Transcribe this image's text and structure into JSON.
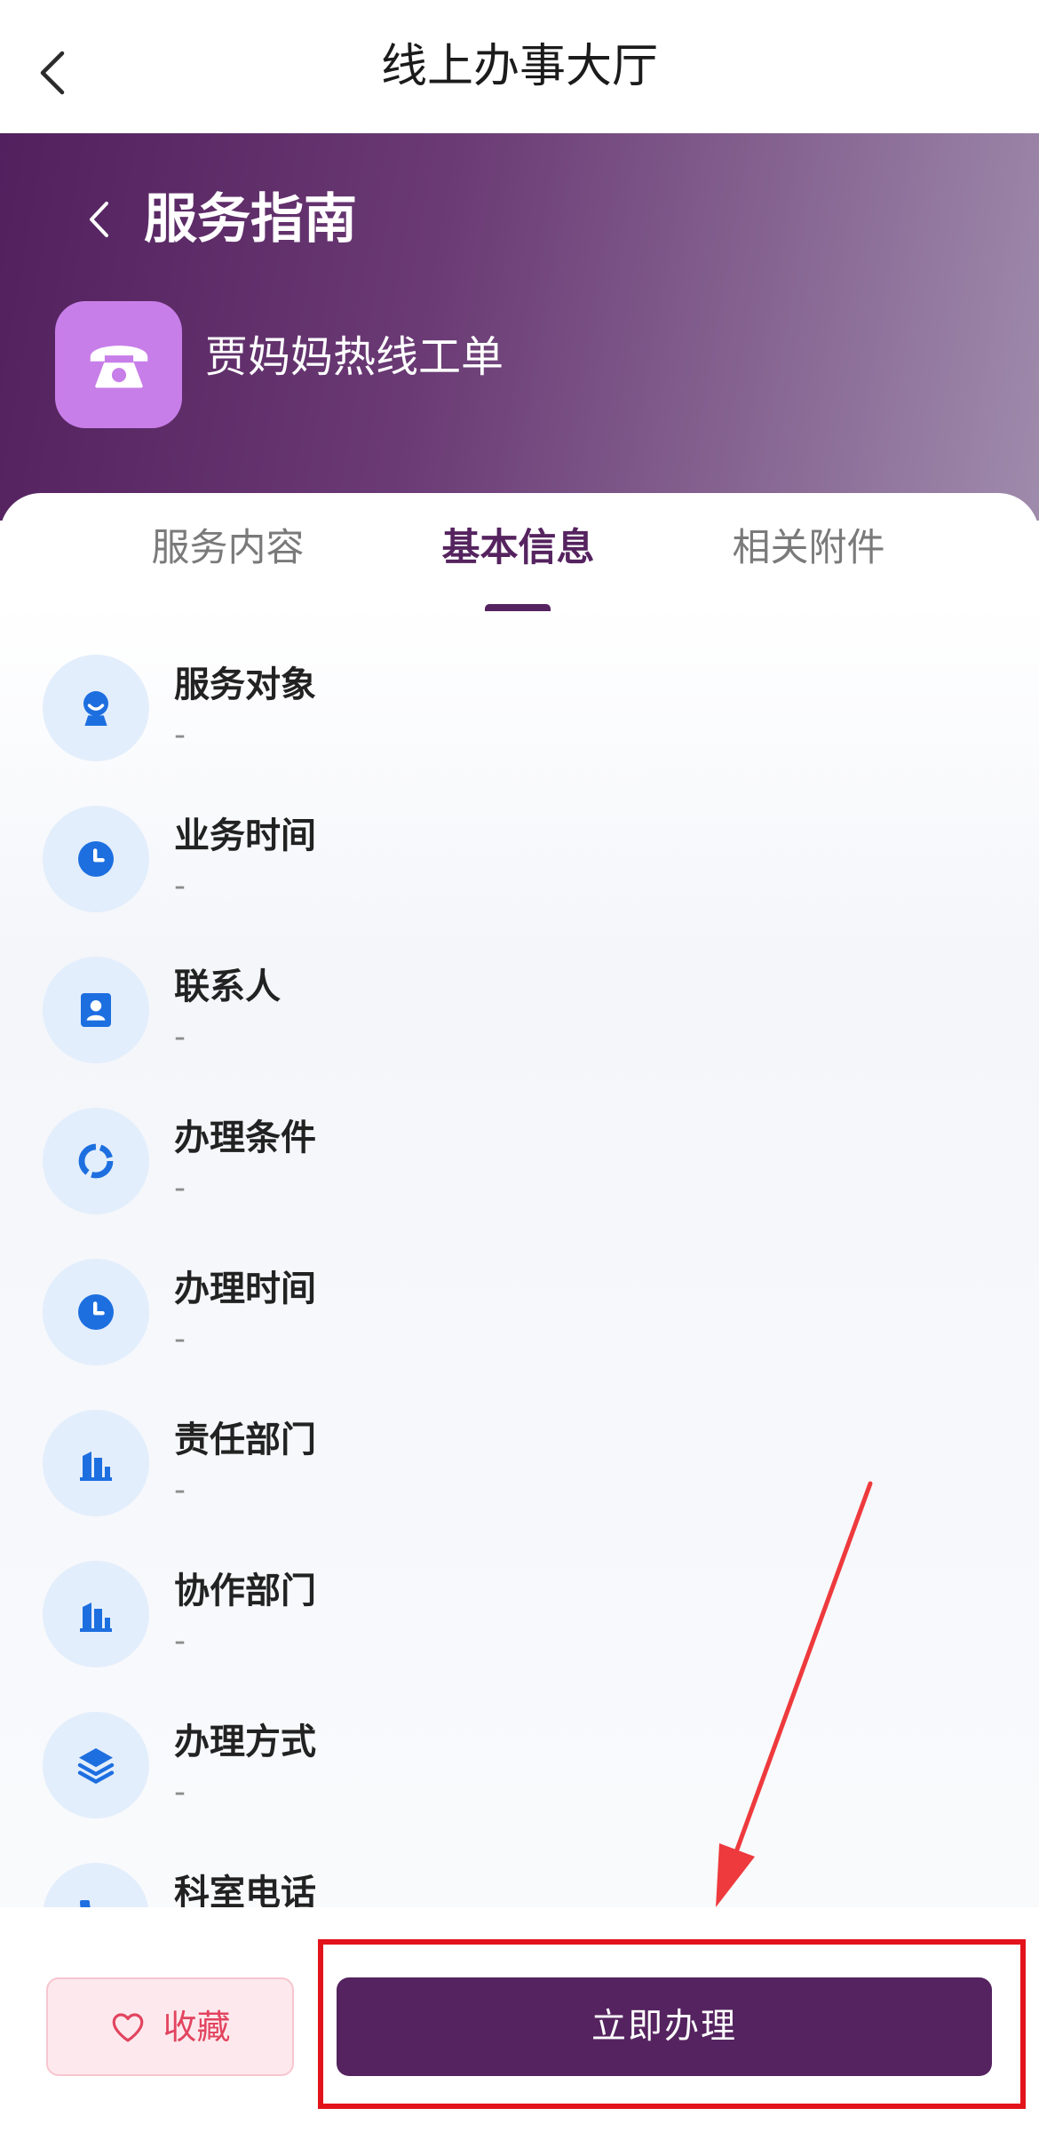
{
  "nav": {
    "title": "线上办事大厅",
    "back_icon": "chevron-left-icon"
  },
  "header": {
    "title": "服务指南",
    "back_icon": "chevron-left-icon",
    "service_name": "贾妈妈热线工单",
    "service_icon": "telephone-icon"
  },
  "tabs": [
    {
      "label": "服务内容",
      "active": false
    },
    {
      "label": "基本信息",
      "active": true
    },
    {
      "label": "相关附件",
      "active": false
    }
  ],
  "info_items": [
    {
      "label": "服务对象",
      "value": "-",
      "icon": "person-icon"
    },
    {
      "label": "业务时间",
      "value": "-",
      "icon": "clock-icon"
    },
    {
      "label": "联系人",
      "value": "-",
      "icon": "contact-card-icon"
    },
    {
      "label": "办理条件",
      "value": "-",
      "icon": "progress-ring-icon"
    },
    {
      "label": "办理时间",
      "value": "-",
      "icon": "clock-icon"
    },
    {
      "label": "责任部门",
      "value": "-",
      "icon": "building-icon"
    },
    {
      "label": "协作部门",
      "value": "-",
      "icon": "building-icon"
    },
    {
      "label": "办理方式",
      "value": "-",
      "icon": "layers-icon"
    },
    {
      "label": "科室电话",
      "icon": "phone-icon"
    }
  ],
  "footer": {
    "favorite_label": "收藏",
    "favorite_icon": "heart-icon",
    "apply_label": "立即办理"
  },
  "colors": {
    "brand": "#55235f",
    "header_gradient_start": "#52205d",
    "header_gradient_end": "#9f8bac",
    "service_icon_bg": "#c87ee9",
    "icon_blue": "#1d6fe0",
    "icon_circle_bg": "#e3eefc",
    "favorite_red": "#e2445f",
    "favorite_bg": "#fde9ed",
    "favorite_border": "#f7c5cf",
    "annotation_red": "#e3131b",
    "annotation_arrow": "#ee3a3d"
  }
}
